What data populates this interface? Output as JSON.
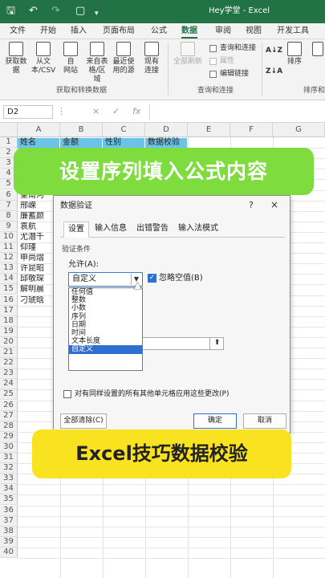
{
  "titlebar": {
    "save_icon": "save-icon",
    "undo_icon": "undo-icon",
    "redo_icon": "redo-icon",
    "new_icon": "new-document-icon",
    "more_icon": "chevron-down-icon",
    "title": "Hey学堂 - Excel",
    "color": "#217346"
  },
  "tabs": [
    "文件",
    "开始",
    "插入",
    "页面布局",
    "公式",
    "数据",
    "审阅",
    "视图",
    "开发工具"
  ],
  "active_tab": "数据",
  "ribbon": {
    "get_data": {
      "label1": "获取数",
      "label2": "据"
    },
    "from_text": {
      "label1": "从文",
      "label2": "本/CSV"
    },
    "from_web": {
      "label1": "自",
      "label2": "网站"
    },
    "from_table": {
      "label1": "来自表",
      "label2": "格/区域"
    },
    "recent_sources": {
      "label1": "最近使",
      "label2": "用的源"
    },
    "existing_conn": {
      "label1": "现有",
      "label2": "连接"
    },
    "refresh_all": {
      "label1": "全部刷新",
      "label2": ""
    },
    "queries_conn": "查询和连接",
    "properties": "属性",
    "edit_links": "编辑链接",
    "sort_label": "排序",
    "group_get": "获取和转换数据",
    "group_queries": "查询和连接",
    "group_sort": "排序和"
  },
  "formula_bar": {
    "name_box": "D2",
    "cancel_icon": "×",
    "enter_icon": "✓",
    "fx": "fx"
  },
  "columns": [
    "A",
    "B",
    "C",
    "D",
    "E",
    "F",
    "G"
  ],
  "rows": [
    "1",
    "2",
    "3",
    "4",
    "5",
    "6",
    "7",
    "8",
    "9",
    "10",
    "11",
    "12",
    "13",
    "14",
    "15",
    "16",
    "17",
    "18",
    "19",
    "20",
    "21",
    "22",
    "23",
    "24",
    "25",
    "26",
    "27",
    "28",
    "29",
    "30",
    "31",
    "32",
    "33",
    "34",
    "35",
    "36",
    "37",
    "38",
    "39",
    "40"
  ],
  "header_row": [
    "姓名",
    "金额",
    "性别",
    "数据校验"
  ],
  "names": [
    "",
    "",
    "",
    "",
    "",
    "皇甫河",
    "邢嵘",
    "廉蓄颜",
    "袁航",
    "尤潜千",
    "仰瑾",
    "申尚熠",
    "许昆昭",
    "邱敬琛",
    "解明晨",
    "刁琥晗"
  ],
  "banner_top": "设置序列填入公式内容",
  "banner_bottom": "Excel技巧数据校验",
  "dialog": {
    "title": "数据验证",
    "help": "?",
    "close": "×",
    "tabs": [
      "设置",
      "输入信息",
      "出错警告",
      "输入法模式"
    ],
    "section": "验证条件",
    "allow_label": "允许(A):",
    "allow_value": "自定义",
    "ignore_blank_label": "忽略空值(B)",
    "options": [
      "任何值",
      "整数",
      "小数",
      "序列",
      "日期",
      "时间",
      "文本长度",
      "自定义"
    ],
    "selected_option": "自定义",
    "apply_all_label": "对有同样设置的所有其他单元格应用这些更改(P)",
    "clear_all": "全部清除(C)",
    "ok": "确定",
    "cancel": "取消"
  }
}
